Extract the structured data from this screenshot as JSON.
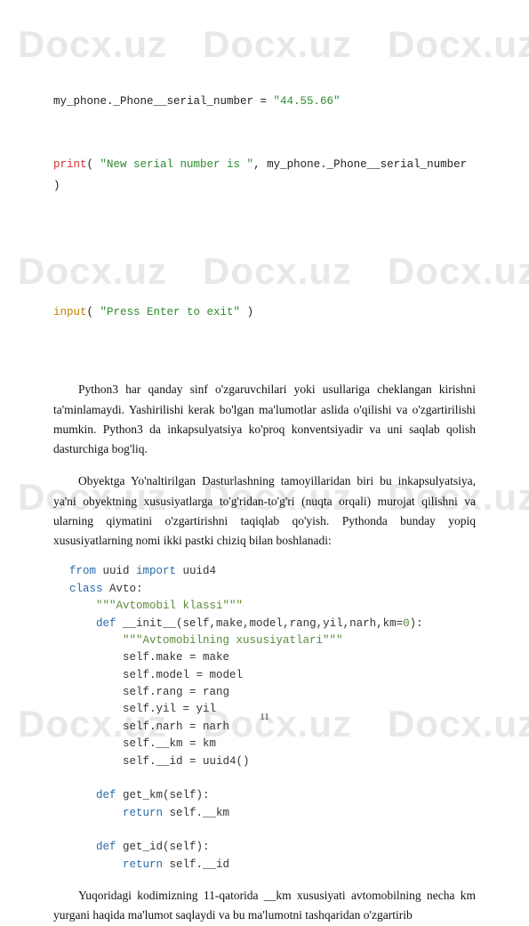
{
  "watermark": "Docx.uz",
  "code1": {
    "l1": {
      "a": "my_phone._Phone__serial_number = ",
      "b": "\"44.55.66\""
    },
    "l2": {
      "a": "print",
      "b": "( ",
      "c": "\"New serial number is \"",
      "d": ", my_phone._Phone__serial_number )"
    },
    "l3": {
      "a": "input",
      "b": "( ",
      "c": "\"Press Enter to exit\"",
      "d": " )"
    }
  },
  "para1": "Python3 har qanday sinf o'zgaruvchilari yoki usullariga cheklangan kirishni ta'minlamaydi. Yashirilishi kerak bo'lgan ma'lumotlar aslida o'qilishi va o'zgartirilishi mumkin. Python3 da inkapsulyatsiya ko'proq konventsiyadir va uni saqlab qolish dasturchiga bog'liq.",
  "para2": "Obyektga Yo'naltirilgan Dasturlashning tamoyillaridan biri bu inkapsulyatsiya, ya'ni obyektning xususiyatlarga to'g'ridan-to'g'ri (nuqta orqali) murojat qilishni va ularning qiymatini o'zgartirishni taqiqlab qo'yish. Pythonda bunday yopiq xususiyatlarning nomi ikki pastki chiziq bilan boshlanadi:",
  "code2": {
    "l01": {
      "a": "from",
      "b": " uuid ",
      "c": "import",
      "d": " uuid4"
    },
    "l02": {
      "a": "class",
      "b": " Avto:"
    },
    "l03": "    \"\"\"Avtomobil klassi\"\"\"",
    "l04": {
      "a": "    ",
      "b": "def",
      "c": " __init__(self,make,model,rang,yil,narh,km=",
      "d": "0",
      "e": "):"
    },
    "l05": "        \"\"\"Avtomobilning xususiyatlari\"\"\"",
    "l06": "        self.make = make",
    "l07": "        self.model = model",
    "l08": "        self.rang = rang",
    "l09": "        self.yil = yil",
    "l10": "        self.narh = narh",
    "l11": "        self.__km = km",
    "l12": "        self.__id = uuid4()",
    "l14": {
      "a": "    ",
      "b": "def",
      "c": " get_km(self):"
    },
    "l15": {
      "a": "        ",
      "b": "return",
      "c": " self.__km"
    },
    "l17": {
      "a": "    ",
      "b": "def",
      "c": " get_id(self):"
    },
    "l18": {
      "a": "        ",
      "b": "return",
      "c": " self.__id"
    }
  },
  "para3": "Yuqoridagi kodimizning 11-qatorida __km xususiyati avtomobilning necha km yurgani haqida ma'lumot saqlaydi va bu ma'lumotni tashqaridan o'zgartirib",
  "page_number": "11"
}
